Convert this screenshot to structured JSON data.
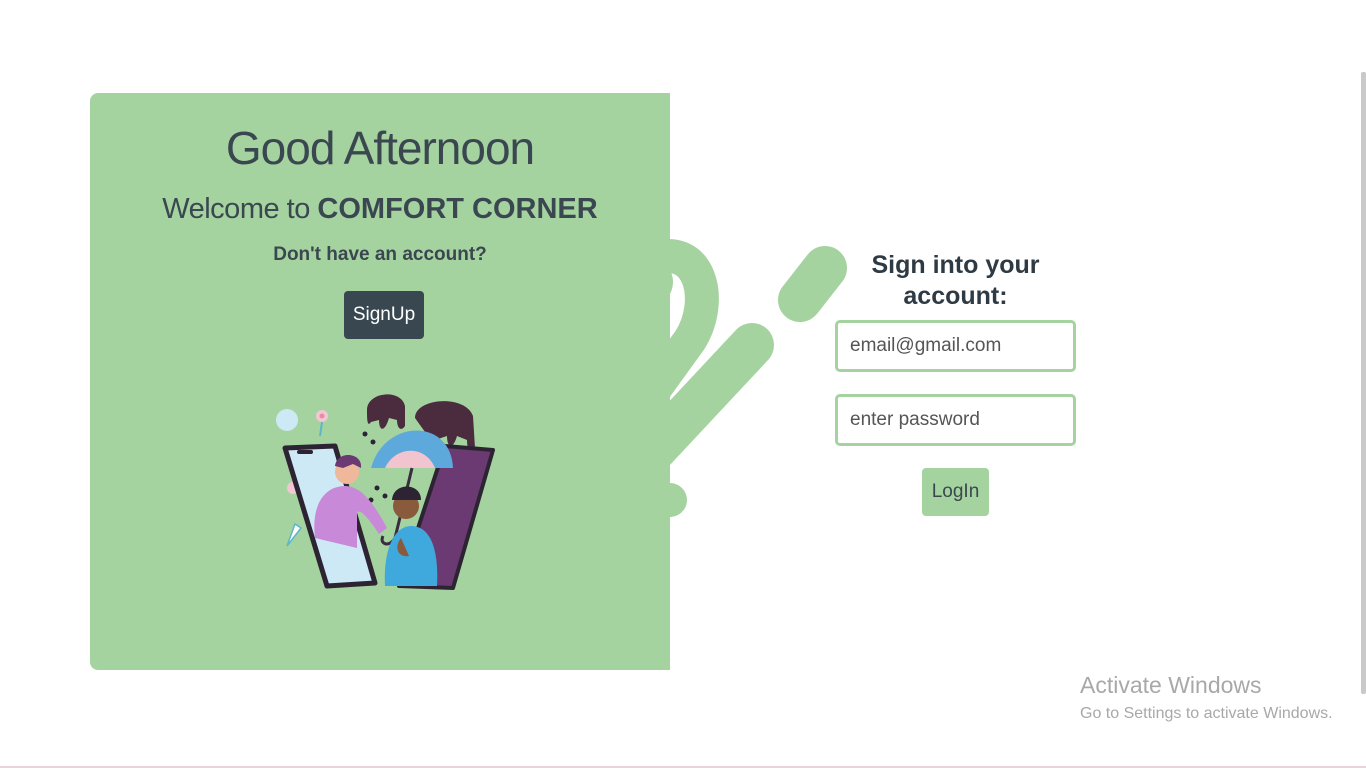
{
  "colors": {
    "panel_green": "#a5d3a0",
    "dark_slate": "#384750",
    "text_dark": "#3a4750",
    "background": "#ffffff"
  },
  "left_panel": {
    "greeting": "Good Afternoon",
    "welcome_prefix": "Welcome to ",
    "brand_name": "COMFORT CORNER",
    "no_account_text": "Don't have an account?",
    "signup_label": "SignUp",
    "illustration_icon": "people-comfort-illustration"
  },
  "login_form": {
    "title": "Sign into your account:",
    "email_placeholder": "email@gmail.com",
    "password_placeholder": "enter password",
    "login_label": "LogIn"
  },
  "watermark": {
    "title": "Activate Windows",
    "subtitle": "Go to Settings to activate Windows."
  }
}
